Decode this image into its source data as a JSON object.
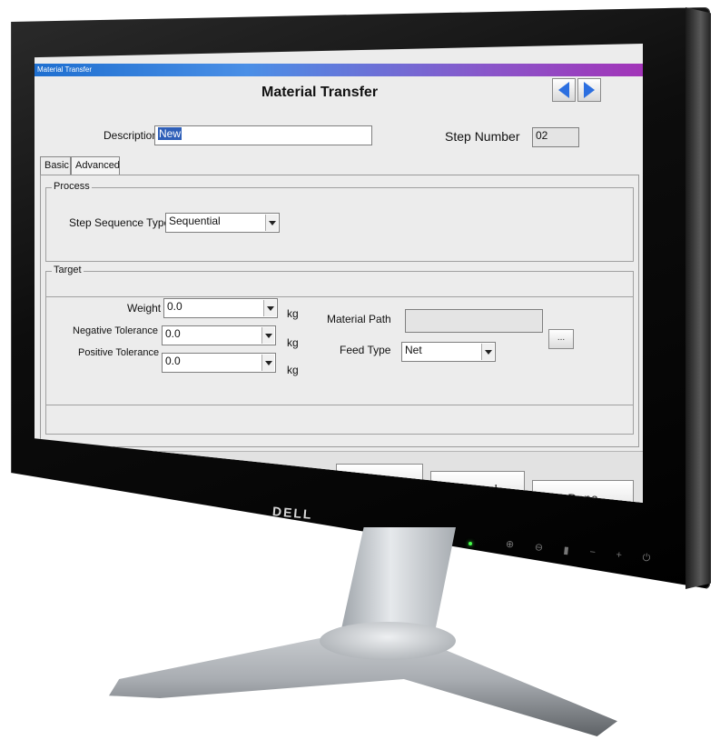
{
  "window": {
    "title": "Material Transfer"
  },
  "form": {
    "title": "Material Transfer"
  },
  "description": {
    "label": "Description",
    "value": "New"
  },
  "step_number": {
    "label": "Step Number",
    "value": "02"
  },
  "tabs": [
    {
      "label": "Basic"
    },
    {
      "label": "Advanced"
    }
  ],
  "process": {
    "legend": "Process",
    "step_sequence_type": {
      "label": "Step Sequence Type",
      "value": "Sequential"
    }
  },
  "target": {
    "legend": "Target",
    "weight": {
      "label": "Weight",
      "value": "0.0",
      "unit": "kg"
    },
    "negative_tolerance": {
      "label": "Negative Tolerance",
      "value": "0.0",
      "unit": "kg"
    },
    "positive_tolerance": {
      "label": "Positive Tolerance",
      "value": "0.0",
      "unit": "kg"
    },
    "material_path": {
      "label": "Material Path",
      "value": "",
      "button": "..."
    },
    "feed_type": {
      "label": "Feed Type",
      "value": "Net"
    }
  },
  "actions": {
    "save": "Save",
    "cancel": "Cancel",
    "done": "Done"
  },
  "hardware": {
    "brand": "DELL"
  },
  "colors": {
    "accent": "#2c6fe0",
    "title_gradient_start": "#1e6fd0",
    "title_gradient_end": "#a234b8"
  },
  "icons": {
    "prev": "triangle-left-icon",
    "next": "triangle-right-icon"
  }
}
